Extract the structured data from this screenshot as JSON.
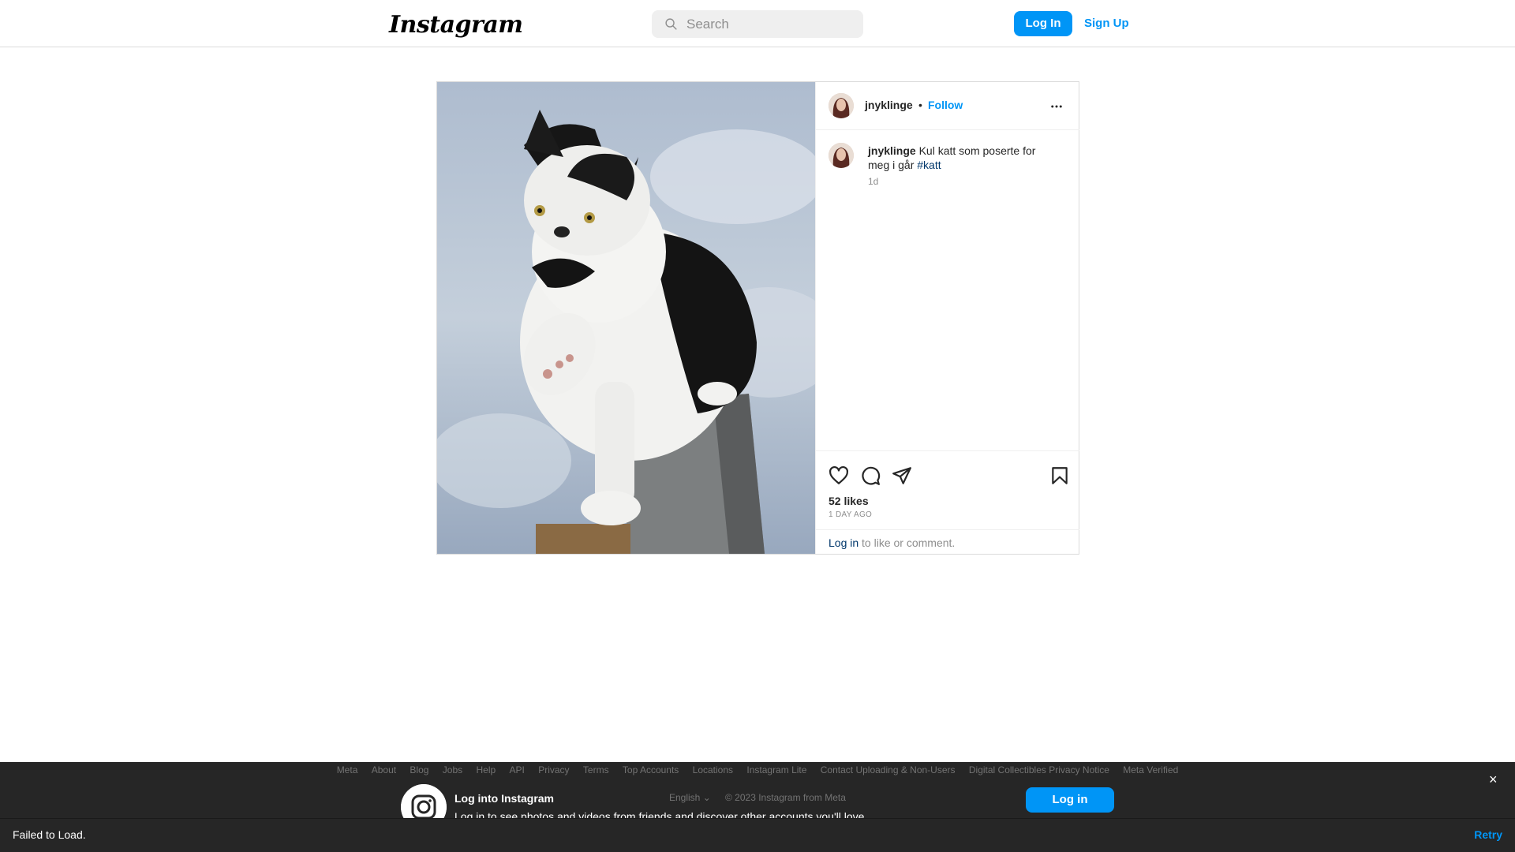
{
  "header": {
    "logo": "Instagram",
    "search_placeholder": "Search",
    "login": "Log In",
    "signup": "Sign Up"
  },
  "post": {
    "username": "jnyklinge",
    "separator": "•",
    "follow": "Follow",
    "caption_user": "jnyklinge",
    "caption_text": " Kul katt som poserte for meg i går ",
    "caption_tag": "#katt",
    "caption_time": "1d",
    "likes": "52 likes",
    "posted_ago": "1 DAY AGO",
    "login_link": "Log in",
    "login_rest": " to like or comment."
  },
  "footer": {
    "links": [
      "Meta",
      "About",
      "Blog",
      "Jobs",
      "Help",
      "API",
      "Privacy",
      "Terms",
      "Top Accounts",
      "Locations",
      "Instagram Lite",
      "Contact Uploading & Non-Users",
      "Digital Collectibles Privacy Notice",
      "Meta Verified"
    ],
    "language": "English",
    "copyright": "© 2023 Instagram from Meta"
  },
  "banner": {
    "title": "Log into Instagram",
    "subtitle": "Log in to see photos and videos from friends and discover other accounts you'll love.",
    "login": "Log in",
    "close": "×"
  },
  "toast": {
    "text": "Failed to Load.",
    "retry": "Retry"
  },
  "colors": {
    "accent": "#0095f6",
    "link_dark": "#00376b",
    "banner_bg": "#262626"
  }
}
